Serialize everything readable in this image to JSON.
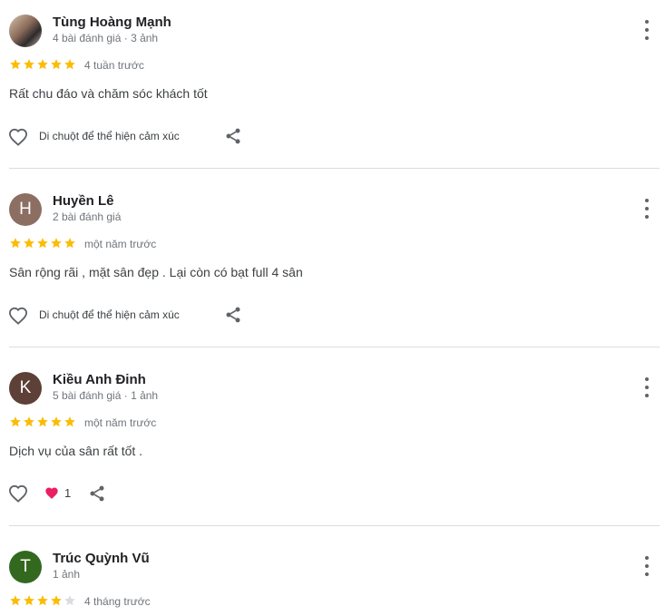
{
  "reviews": [
    {
      "name": "Tùng Hoàng Mạnh",
      "meta": "4 bài đánh giá · 3 ảnh",
      "avatar_letter": "",
      "avatar_color": "",
      "rating": 5,
      "time": "4 tuần trước",
      "text": "Rất chu đáo và chăm sóc khách tốt",
      "reaction_hint": "Di chuột để thể hiện cảm xúc"
    },
    {
      "name": "Huyền Lê",
      "meta": "2 bài đánh giá",
      "avatar_letter": "H",
      "avatar_color": "#8d6e63",
      "rating": 5,
      "time": "một năm trước",
      "text": "Sân rộng rãi , mặt sân đẹp . Lại còn có bạt full 4 sân",
      "reaction_hint": "Di chuột để thể hiện cảm xúc"
    },
    {
      "name": "Kiều Anh Đinh",
      "meta": "5 bài đánh giá · 1 ảnh",
      "avatar_letter": "K",
      "avatar_color": "#5d4037",
      "rating": 5,
      "time": "một năm trước",
      "text": "Dịch vụ của sân rất tốt .",
      "reaction_count": "1"
    },
    {
      "name": "Trúc Quỳnh Vũ",
      "meta": "1 ảnh",
      "avatar_letter": "T",
      "avatar_color": "#33691e",
      "rating": 4,
      "time": "4 tháng trước"
    }
  ],
  "colors": {
    "star_filled": "#fbbc04",
    "star_empty": "#dadce0",
    "reaction_heart": "#e91e63",
    "icon_gray": "#5f6368"
  },
  "icons": {
    "more": "more-vert-icon",
    "like": "heart-outline-icon",
    "share": "share-icon",
    "reaction": "heart-filled-icon"
  }
}
